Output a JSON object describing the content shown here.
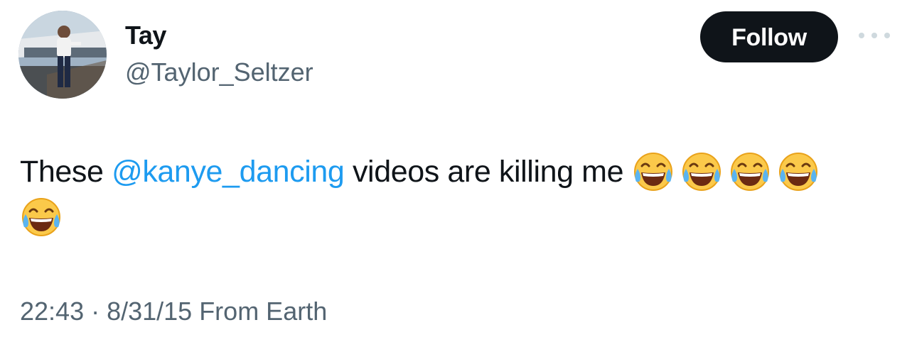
{
  "profile": {
    "display_name": "Tay",
    "handle": "@Taylor_Seltzer",
    "avatar_icon": "profile-photo"
  },
  "actions": {
    "follow_label": "Follow",
    "more_icon": "more-horizontal-icon"
  },
  "tweet": {
    "text_before": "These ",
    "mention": "@kanye_dancing",
    "text_after": " videos are killing me",
    "emoji_name": "face-with-tears-of-joy-icon",
    "emoji_count": 5,
    "timestamp": "22:43 · 8/31/15 From Earth"
  },
  "colors": {
    "link": "#1d9bf0",
    "secondary_text": "#536471",
    "button_bg": "#0f1419"
  }
}
